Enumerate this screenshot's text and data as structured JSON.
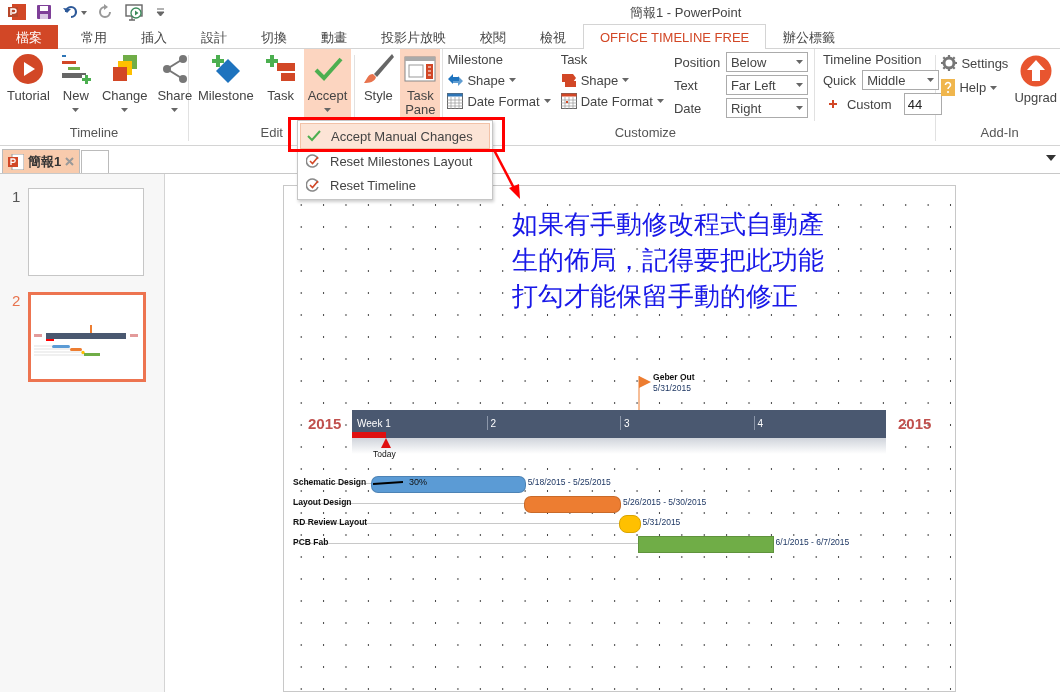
{
  "window": {
    "title": "簡報1 - PowerPoint"
  },
  "ribbon_tabs": [
    {
      "label": "檔案",
      "kind": "file",
      "selected": false
    },
    {
      "label": "常用",
      "kind": "tab",
      "selected": false
    },
    {
      "label": "插入",
      "kind": "tab",
      "selected": false
    },
    {
      "label": "設計",
      "kind": "tab",
      "selected": false
    },
    {
      "label": "切換",
      "kind": "tab",
      "selected": false
    },
    {
      "label": "動畫",
      "kind": "tab",
      "selected": false
    },
    {
      "label": "投影片放映",
      "kind": "tab",
      "selected": false
    },
    {
      "label": "校閱",
      "kind": "tab",
      "selected": false
    },
    {
      "label": "檢視",
      "kind": "tab",
      "selected": false
    },
    {
      "label": "OFFICE TIMELINE FREE",
      "kind": "tab",
      "selected": true
    },
    {
      "label": "辦公標籤",
      "kind": "tab",
      "selected": false
    }
  ],
  "ribbon": {
    "timeline_group": {
      "label": "Timeline",
      "buttons": [
        {
          "label": "Tutorial",
          "dropdown": false
        },
        {
          "label": "New",
          "dropdown": true
        },
        {
          "label": "Change",
          "dropdown": true
        },
        {
          "label": "Share",
          "dropdown": true
        }
      ]
    },
    "edit_group": {
      "label": "Edit",
      "buttons": [
        {
          "label": "Milestone",
          "dropdown": false,
          "pressed": false
        },
        {
          "label": "Task",
          "dropdown": false,
          "pressed": false
        },
        {
          "label": "Accept",
          "dropdown": true,
          "pressed": true
        }
      ]
    },
    "customize_group": {
      "label": "Customize",
      "buttons": [
        {
          "label": "Style",
          "pressed": false
        },
        {
          "label": "Task Pane",
          "pressed": true
        }
      ],
      "columns": [
        {
          "heading": "Milestone",
          "items": [
            "Shape",
            "Date Format"
          ]
        },
        {
          "heading": "Task",
          "items": [
            "Shape",
            "Date Format"
          ]
        }
      ],
      "selects": [
        {
          "label": "Position",
          "value": "Below"
        },
        {
          "label": "Text",
          "value": "Far Left"
        },
        {
          "label": "Date",
          "value": "Right"
        }
      ],
      "timeline_position": {
        "heading": "Timeline Position",
        "quick_label": "Quick",
        "quick_value": "Middle",
        "custom_label": "Custom",
        "custom_value": "44"
      }
    },
    "addin_group": {
      "label": "Add-In",
      "settings": "Settings",
      "help": "Help",
      "upgrade": "Upgrad"
    }
  },
  "accept_menu": [
    {
      "label": "Accept Manual Changes",
      "kind": "check",
      "selected": true
    },
    {
      "label": "Reset Milestones Layout",
      "kind": "reset",
      "selected": false
    },
    {
      "label": "Reset Timeline",
      "kind": "reset",
      "selected": false
    }
  ],
  "document_tabs": [
    {
      "label": "簡報1",
      "selected": true
    }
  ],
  "slides": [
    {
      "number": "1",
      "selected": false,
      "kind": "blank"
    },
    {
      "number": "2",
      "selected": true,
      "kind": "timeline"
    }
  ],
  "annotation": "如果有手動修改程式自動產生的佈局，記得要把此功能打勾才能保留手動的修正",
  "timeline": {
    "year_start": "2015",
    "year_end": "2015",
    "weeks": [
      "Week 1",
      "2",
      "3",
      "4"
    ],
    "today": "Today",
    "milestones_above": [
      {
        "title": "Geber Out",
        "date": "5/31/2015",
        "color": "#ed7d31"
      }
    ],
    "tasks": [
      {
        "name": "Schematic Design",
        "kind": "task",
        "dates": "5/18/2015 - 5/25/2015",
        "color": "#5b9bd5",
        "percent": "30%"
      },
      {
        "name": "Layout Design",
        "kind": "task",
        "dates": "5/26/2015 - 5/30/2015",
        "color": "#ed7d31"
      },
      {
        "name": "RD Review Layout",
        "kind": "milestone",
        "dates": "5/31/2015",
        "color": "#ffc000"
      },
      {
        "name": "PCB Fab",
        "kind": "task",
        "dates": "6/1/2015 - 6/7/2015",
        "color": "#70ad47"
      }
    ]
  }
}
